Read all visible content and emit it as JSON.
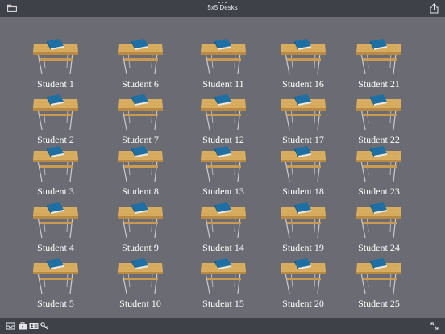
{
  "header": {
    "title": "5x5 Desks"
  },
  "students": [
    "Student 1",
    "Student 2",
    "Student 3",
    "Student 4",
    "Student 5",
    "Student 6",
    "Student 7",
    "Student 8",
    "Student 9",
    "Student 10",
    "Student 11",
    "Student 12",
    "Student 13",
    "Student 14",
    "Student 15",
    "Student 16",
    "Student 17",
    "Student 18",
    "Student 19",
    "Student 20",
    "Student 21",
    "Student 22",
    "Student 23",
    "Student 24",
    "Student 25"
  ],
  "icons": {
    "top_left": "folder-icon",
    "top_center": "more-dots-icon",
    "top_right": "share-icon",
    "bottom_1": "inbox-tray-icon",
    "bottom_2": "briefcase-icon",
    "bottom_3": "id-card-icon",
    "bottom_4": "key-icon",
    "bottom_right": "expand-icon"
  },
  "colors": {
    "background": "#6b6b73",
    "bar": "#3f4148",
    "desk_top": "#d6a95c",
    "book": "#1e6fa3"
  }
}
